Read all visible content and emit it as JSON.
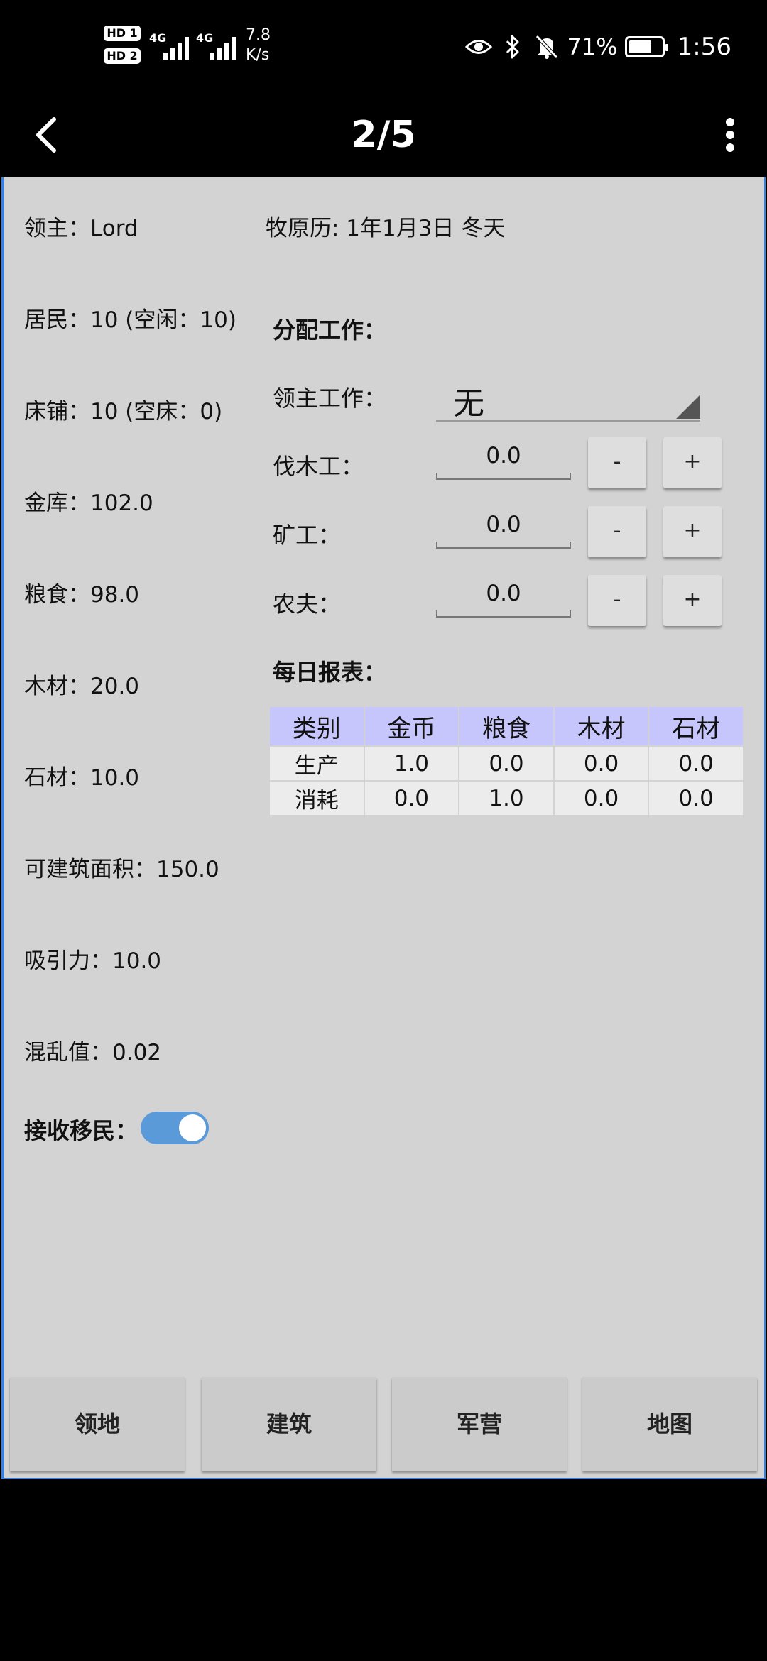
{
  "status_bar": {
    "hd1": "HD 1",
    "hd2": "HD 2",
    "net1": "4G",
    "net2": "4G",
    "speed_value": "7.8",
    "speed_unit": "K/s",
    "battery_percent": "71%",
    "battery_level": 0.71,
    "time": "1:56",
    "icons": [
      "eye-icon",
      "bluetooth-icon",
      "bell-off-icon"
    ]
  },
  "title_bar": {
    "title": "2/5",
    "back_icon": "chevron-left-icon",
    "more_icon": "more-vertical-icon"
  },
  "stats": {
    "lord": "领主：Lord",
    "residents": "居民：10 (空闲：10)",
    "beds": "床铺：10 (空床：0)",
    "treasury": "金库：102.0",
    "food": "粮食：98.0",
    "wood": "木材：20.0",
    "stone": "石材：10.0",
    "buildable_area": "可建筑面积：150.0",
    "attraction": "吸引力：10.0",
    "chaos": "混乱值：0.02",
    "accept_migrants_label": "接收移民：",
    "accept_migrants_on": true
  },
  "calendar": {
    "date": "牧原历: 1年1月3日  冬天"
  },
  "jobs": {
    "section_title": "分配工作：",
    "lord_job_label": "领主工作：",
    "lord_job_value": "无",
    "woodcutter_label": "伐木工：",
    "woodcutter_value": "0.0",
    "miner_label": "矿工：",
    "miner_value": "0.0",
    "farmer_label": "农夫：",
    "farmer_value": "0.0",
    "minus_label": "-",
    "plus_label": "+"
  },
  "report": {
    "title": "每日报表：",
    "headers": [
      "类别",
      "金币",
      "粮食",
      "木材",
      "石材"
    ],
    "rows": [
      [
        "生产",
        "1.0",
        "0.0",
        "0.0",
        "0.0"
      ],
      [
        "消耗",
        "0.0",
        "1.0",
        "0.0",
        "0.0"
      ]
    ]
  },
  "tabs": [
    "领地",
    "建筑",
    "军营",
    "地图"
  ],
  "colors": {
    "panel_bg": "#d3d3d3",
    "table_header_bg": "#c6c6fd",
    "toggle_on": "#5b9ad9",
    "panel_border": "#3d7fd6"
  }
}
